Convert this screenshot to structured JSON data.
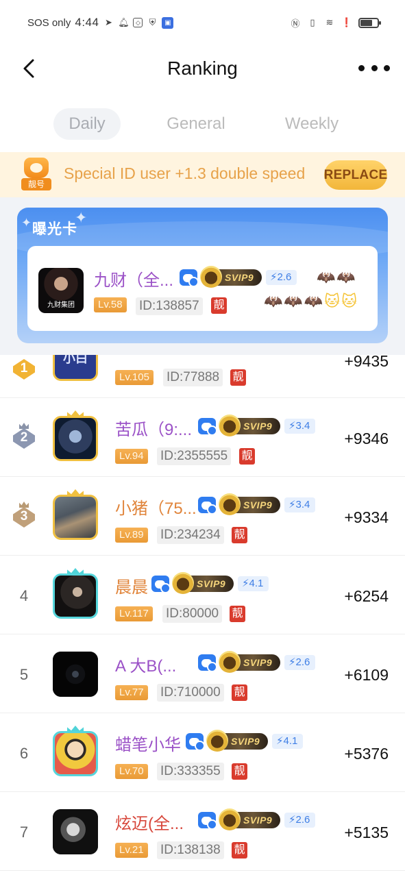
{
  "status_bar": {
    "carrier": "SOS only",
    "time": "4:44",
    "battery_level": 0.7
  },
  "header": {
    "title": "Ranking",
    "back_icon": "chevron-left-icon",
    "more_icon": "more-dots-icon"
  },
  "tabs": [
    {
      "label": "Daily",
      "active": true
    },
    {
      "label": "General",
      "active": false
    },
    {
      "label": "Weekly",
      "active": false
    }
  ],
  "promo": {
    "badge_label": "靓号",
    "text": "Special ID user +1.3 double speed",
    "button_label": "REPLACE"
  },
  "exposure_card": {
    "title": "曝光卡",
    "user": {
      "name": "九财（全...",
      "avatar_caption": "九财集团",
      "speed": "2.6",
      "level": "Lv.58",
      "id": "ID:138857",
      "special_tag": "靓",
      "svip_label": "SVIP9",
      "decorations_row1": "🦇🦇",
      "decorations_row2": "🦇🦇🦇🐱🐱"
    }
  },
  "colors": {
    "accent_blue": "#2f7cf0",
    "level_orange": "#e99a36",
    "special_red": "#d93b2d",
    "promo_bg": "#fff4df",
    "purple_name": "#9b52c7",
    "orange_name": "#e0843a",
    "red_name": "#d7463a"
  },
  "ranking": [
    {
      "rank": "1",
      "name": "",
      "level": "Lv.105",
      "id": "ID:77888",
      "special_tag": "靓",
      "score": "+9435",
      "avatar_text": "小白"
    },
    {
      "rank": "2",
      "name": "苦瓜（9:...",
      "speed": "3.4",
      "svip_label": "SVIP9",
      "level": "Lv.94",
      "id": "ID:2355555",
      "special_tag": "靓",
      "score": "+9346"
    },
    {
      "rank": "3",
      "name": "小猪（75...",
      "speed": "3.4",
      "svip_label": "SVIP9",
      "level": "Lv.89",
      "id": "ID:234234",
      "special_tag": "靓",
      "score": "+9334"
    },
    {
      "rank": "4",
      "name": "晨晨",
      "speed": "4.1",
      "svip_label": "SVIP9",
      "level": "Lv.117",
      "id": "ID:80000",
      "special_tag": "靓",
      "score": "+6254"
    },
    {
      "rank": "5",
      "name": "A  大B(...",
      "speed": "2.6",
      "svip_label": "SVIP9",
      "level": "Lv.77",
      "id": "ID:710000",
      "special_tag": "靓",
      "score": "+6109"
    },
    {
      "rank": "6",
      "name": "蜡笔小华",
      "speed": "4.1",
      "svip_label": "SVIP9",
      "level": "Lv.70",
      "id": "ID:333355",
      "special_tag": "靓",
      "score": "+5376"
    },
    {
      "rank": "7",
      "name": "炫迈(全...",
      "speed": "2.6",
      "svip_label": "SVIP9",
      "level": "Lv.21",
      "id": "ID:138138",
      "special_tag": "靓",
      "score": "+5135"
    }
  ]
}
